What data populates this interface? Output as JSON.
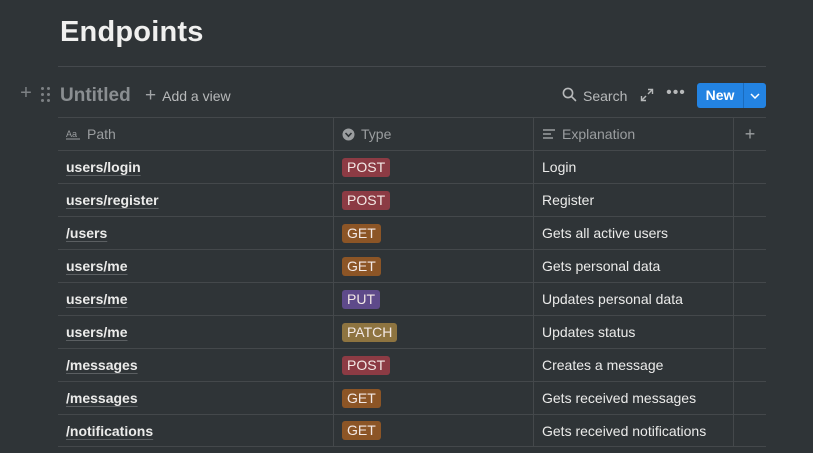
{
  "page": {
    "title": "Endpoints"
  },
  "view": {
    "title": "Untitled",
    "add_view_label": "Add a view",
    "search_label": "Search",
    "new_label": "New"
  },
  "columns": {
    "path": "Path",
    "type": "Type",
    "explanation": "Explanation"
  },
  "tag_colors": {
    "POST": "#8c3b44",
    "GET": "#8c5526",
    "PUT": "#5e4a8a",
    "PATCH": "#8e7440"
  },
  "rows": [
    {
      "path": "users/login",
      "type": "POST",
      "explanation": "Login"
    },
    {
      "path": "users/register",
      "type": "POST",
      "explanation": "Register"
    },
    {
      "path": "/users",
      "type": "GET",
      "explanation": "Gets all active users"
    },
    {
      "path": "users/me",
      "type": "GET",
      "explanation": "Gets personal data"
    },
    {
      "path": "users/me",
      "type": "PUT",
      "explanation": "Updates personal data"
    },
    {
      "path": "users/me",
      "type": "PATCH",
      "explanation": "Updates status"
    },
    {
      "path": "/messages",
      "type": "POST",
      "explanation": "Creates a message"
    },
    {
      "path": "/messages",
      "type": "GET",
      "explanation": "Gets received messages"
    },
    {
      "path": "/notifications",
      "type": "GET",
      "explanation": "Gets received notifications"
    }
  ]
}
